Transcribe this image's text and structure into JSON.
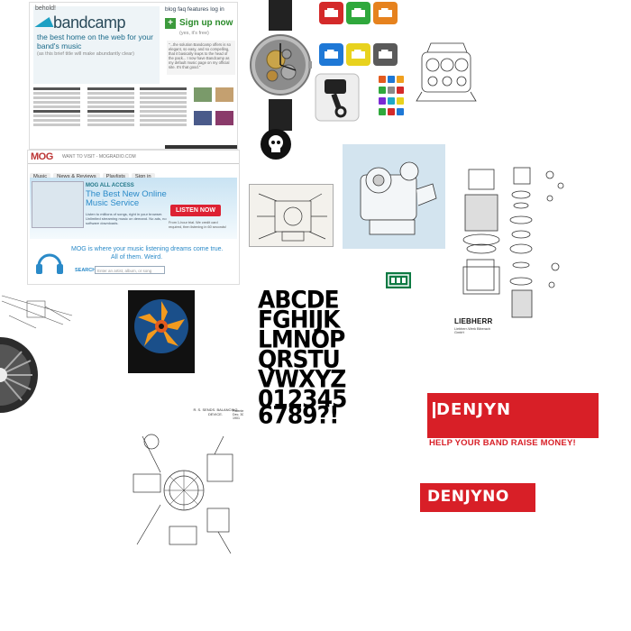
{
  "bandcamp": {
    "behold": "behold!",
    "logo": "bandcamp",
    "tagline": "the best home on the web for your band's music",
    "subline": "(as this brief title will make abundantly clear)",
    "nav": "blog  faq  features  log in",
    "signup": "Sign up now",
    "free": "(yes, it's free)",
    "quote": "\"...the solution Bandcamp offers is so elegant, so easy, and so compelling, that it basically leaps to the head of the pack... I now have Bandcamp as my default music page on my official site. It's that good.\"",
    "accent": "#1da0c3",
    "signup_color": "#3c9a3c"
  },
  "mog": {
    "brand": "MOG",
    "header_text": "WANT TO VISIT - MOGRADIO.COM",
    "tabs": [
      "Music",
      "News & Reviews",
      "Playlists",
      "Sign in"
    ],
    "all_access": "MOG ALL ACCESS",
    "headline": "The Best New Online Music Service",
    "bullets": "Listen to millions of songs, right in your browser. Unlimited streaming music on demand. No ads, no software downloads.",
    "listen_button": "LISTEN NOW",
    "fine_print": "From 1-hour trial. We credit card required, then listening in 60 seconds!",
    "dream_line1": "MOG is where your music listening dreams come true.",
    "dream_line2": "All of them. Weird.",
    "search_label": "SEARCH:",
    "search_placeholder": "Enter an artist, album, or song",
    "accent": "#2a8ac8",
    "brand_color": "#b33333"
  },
  "font_specimen": {
    "rows": [
      "ABCDE",
      "FGHIJK",
      "LMNOP",
      "QRSTU",
      "VWXYZ",
      "012345",
      "6789?!"
    ]
  },
  "liebherr": {
    "name": "LIEBHERR",
    "caption": "Liebherr-Werk Biberach GmbH"
  },
  "denjyn": {
    "logo1": "DENJYN",
    "slogan": "HELP YOUR BAND RAISE MONEY!",
    "logo2": "DENJYNO",
    "red": "#d81f27"
  },
  "patent": {
    "header": "R. S. SENDS. BALANCING DEVICE.",
    "number": "Patented Dec. 30, 1901"
  },
  "icons": {
    "engine_colors": [
      "#d42a2a",
      "#2fa83c",
      "#e6821e",
      "#1e78d6",
      "#e8d21e",
      "#5a5a5a"
    ],
    "names": [
      "engine-icon",
      "piston-icon",
      "skull-icon",
      "exit-icon"
    ]
  }
}
